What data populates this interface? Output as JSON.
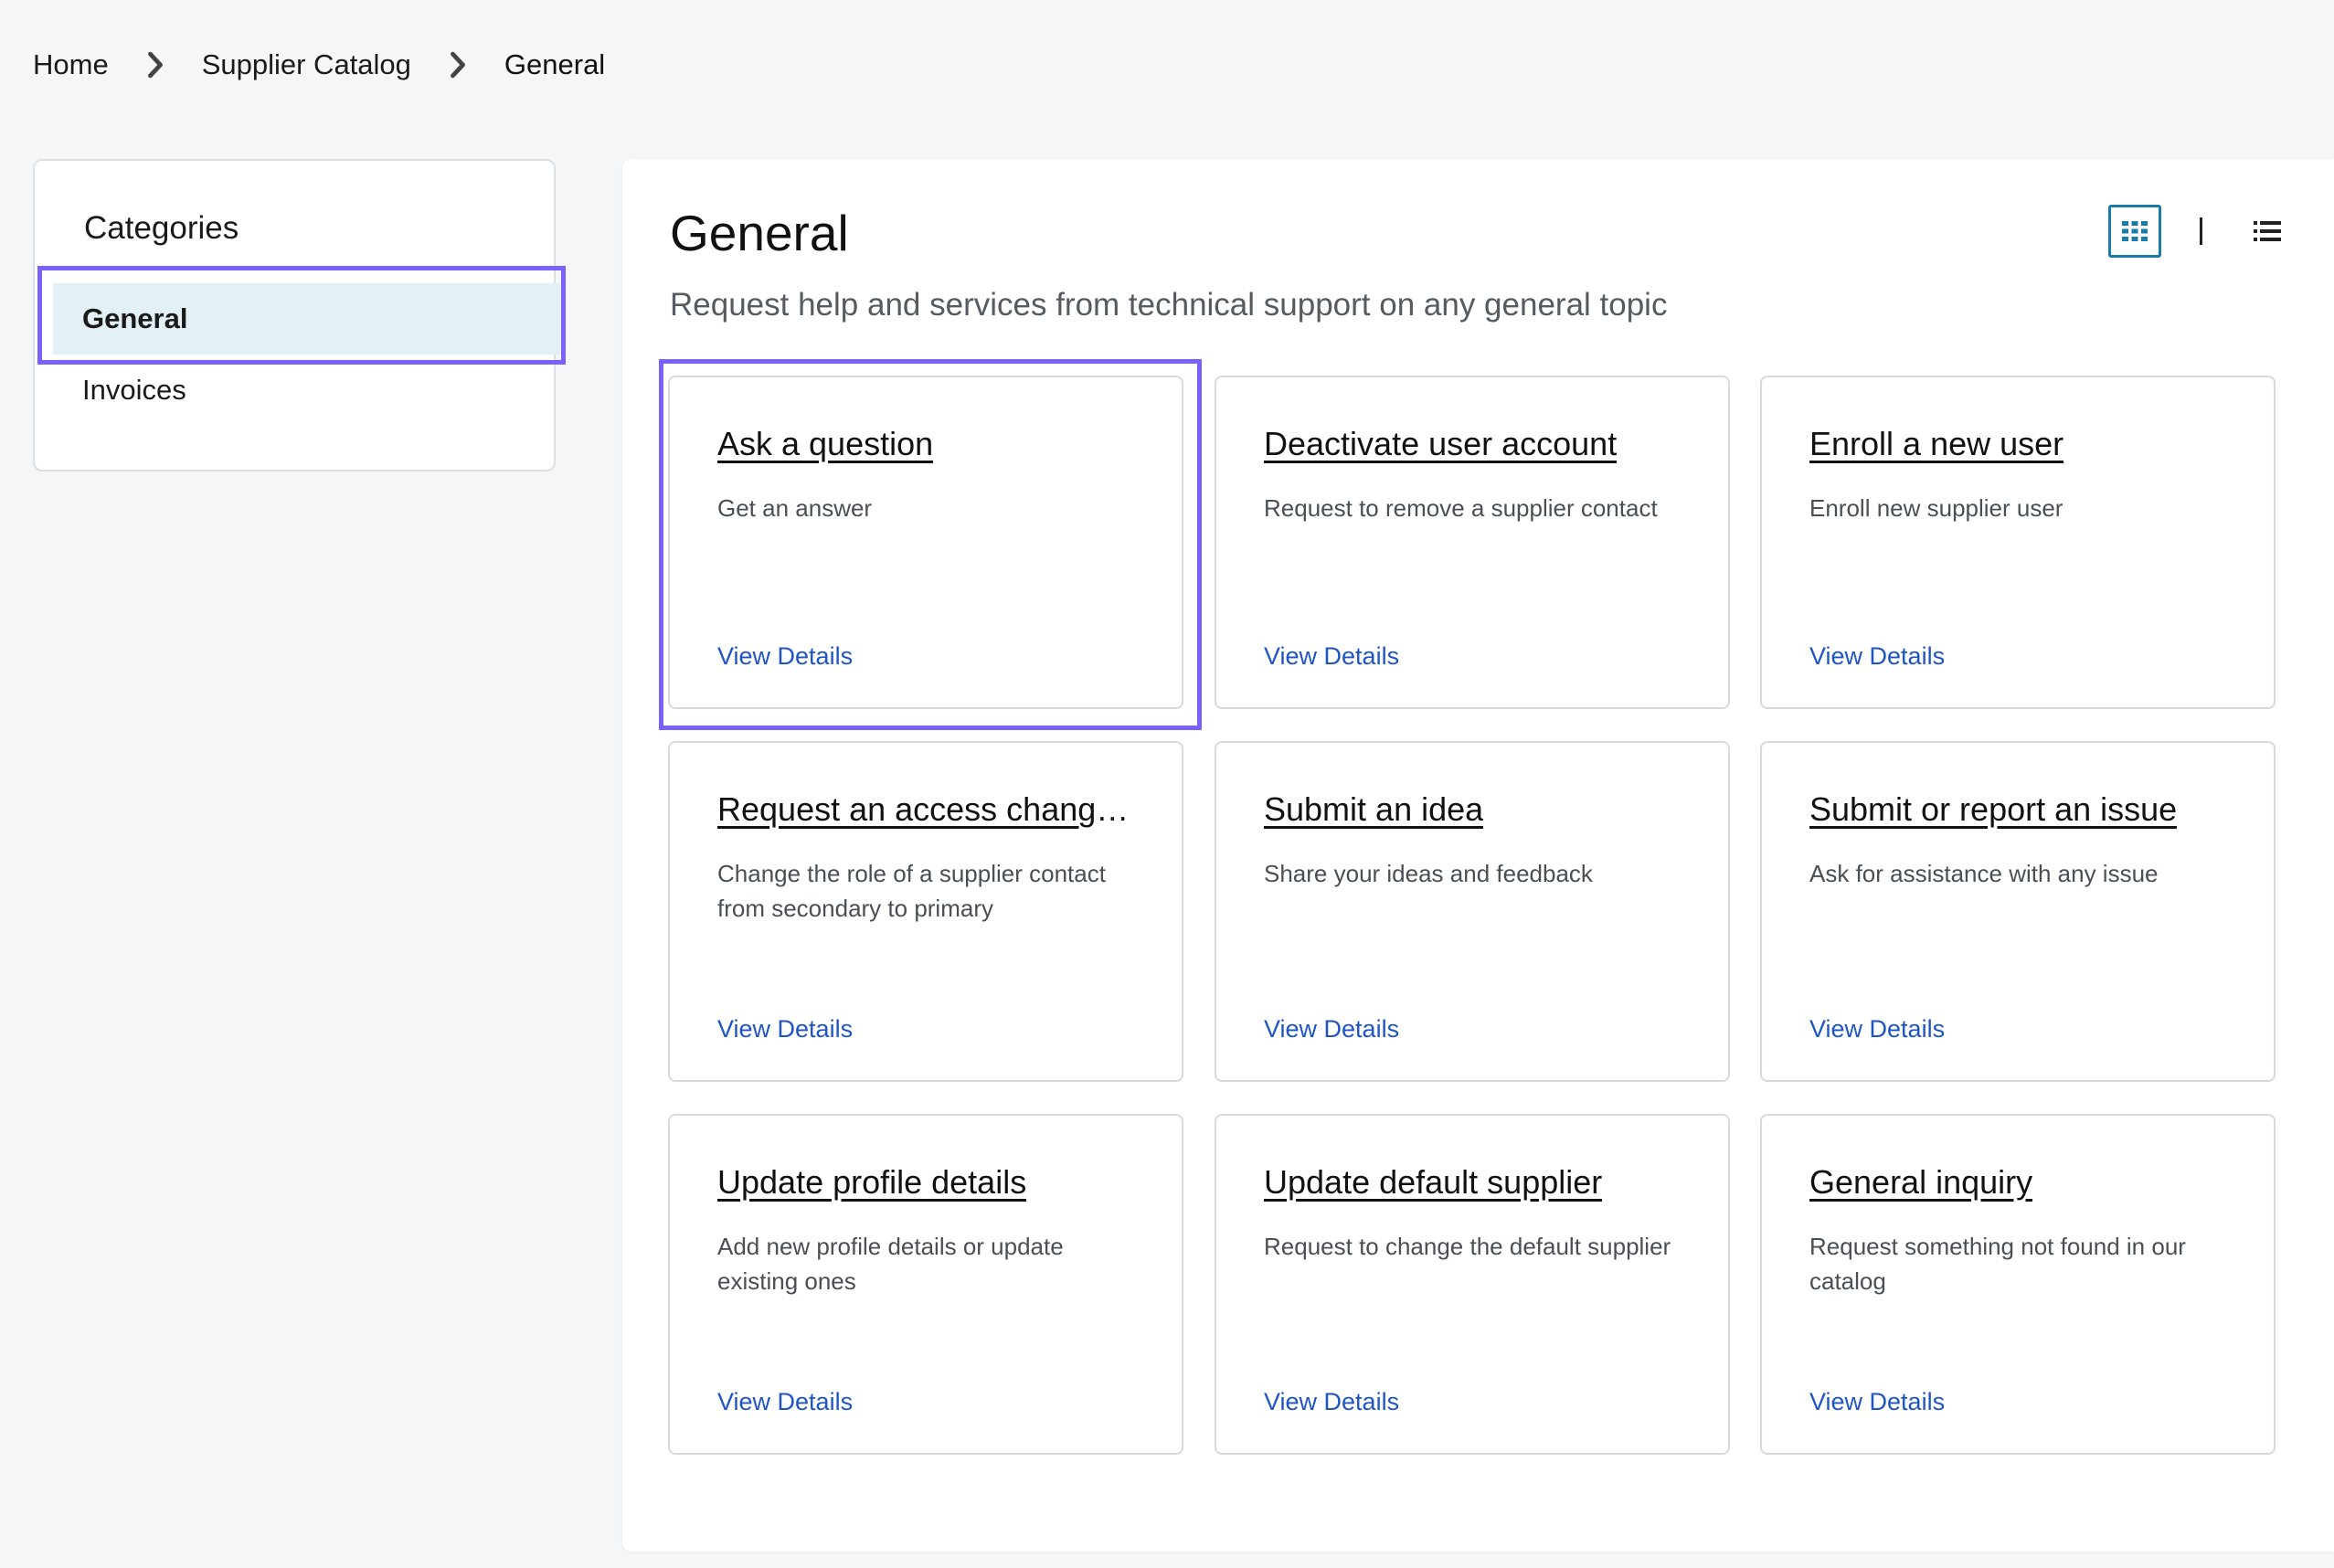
{
  "breadcrumb": {
    "home": "Home",
    "catalog": "Supplier Catalog",
    "current": "General"
  },
  "sidebar": {
    "title": "Categories",
    "items": [
      {
        "label": "General",
        "selected": true
      },
      {
        "label": "Invoices",
        "selected": false
      }
    ]
  },
  "main": {
    "title": "General",
    "subtitle": "Request help and services from technical support on any general topic",
    "view_toggle": {
      "selected": "grid",
      "icons": [
        "grid-view-icon",
        "list-view-icon"
      ]
    },
    "cards": [
      {
        "title": "Ask a question",
        "description": "Get an answer",
        "link": "View Details"
      },
      {
        "title": "Deactivate user account",
        "description": "Request to remove a supplier contact",
        "link": "View Details"
      },
      {
        "title": "Enroll a new user",
        "description": "Enroll new supplier user",
        "link": "View Details"
      },
      {
        "title": "Request an access change r...",
        "description": "Change the role of a supplier contact from secondary to primary",
        "link": "View Details"
      },
      {
        "title": "Submit an idea",
        "description": "Share your ideas and feedback",
        "link": "View Details"
      },
      {
        "title": "Submit or report an issue",
        "description": "Ask for assistance with any issue",
        "link": "View Details"
      },
      {
        "title": "Update profile details",
        "description": "Add new profile details or update existing ones",
        "link": "View Details"
      },
      {
        "title": "Update default supplier",
        "description": "Request to change the default supplier",
        "link": "View Details"
      },
      {
        "title": "General inquiry",
        "description": "Request something not found in our catalog",
        "link": "View Details"
      }
    ]
  },
  "colors": {
    "highlight": "#7b61ff",
    "link": "#1f55c3",
    "selected_bg": "#e3f0f5",
    "toggle_accent": "#1b7ba8"
  }
}
